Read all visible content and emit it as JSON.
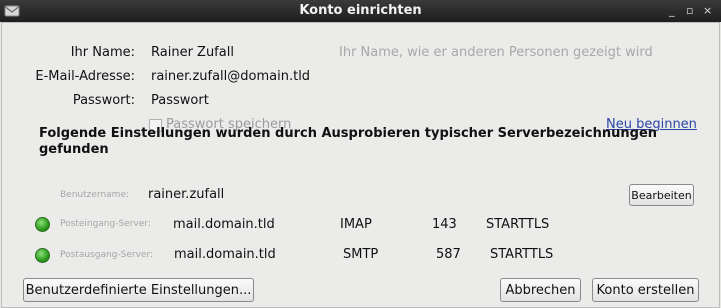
{
  "window": {
    "title": "Konto einrichten",
    "controls": [
      "_",
      "▫",
      "×"
    ]
  },
  "form": {
    "name_label": "Ihr Name:",
    "name_value": "Rainer Zufall",
    "name_hint": "Ihr Name, wie er anderen Personen gezeigt wird",
    "email_label": "E-Mail-Adresse:",
    "email_value": "rainer.zufall@domain.tld",
    "password_label": "Passwort:",
    "password_value": "Passwort",
    "remember_password_label": "Passwort speichern",
    "remember_password_checked": false,
    "restart_link": "Neu beginnen"
  },
  "detected": {
    "heading": "Folgende Einstellungen wurden durch Ausprobieren typischer Serverbezeichnungen gefunden",
    "username_label": "Benutzername:",
    "username_value": "rainer.zufall",
    "edit_button": "Bearbeiten",
    "incoming": {
      "label": "Posteingang-Server:",
      "host": "mail.domain.tld",
      "protocol": "IMAP",
      "port": "143",
      "security": "STARTTLS",
      "status": "ok"
    },
    "outgoing": {
      "label": "Postausgang-Server:",
      "host": "mail.domain.tld",
      "protocol": "SMTP",
      "port": "587",
      "security": "STARTTLS",
      "status": "ok"
    }
  },
  "buttons": {
    "custom_settings": "Benutzerdefinierte Einstellungen...",
    "cancel": "Abbrechen",
    "create_account": "Konto erstellen"
  },
  "colors": {
    "status_ok": "#2c9c1e",
    "link": "#2a46a7",
    "titlebar": "#2a2a2a"
  }
}
